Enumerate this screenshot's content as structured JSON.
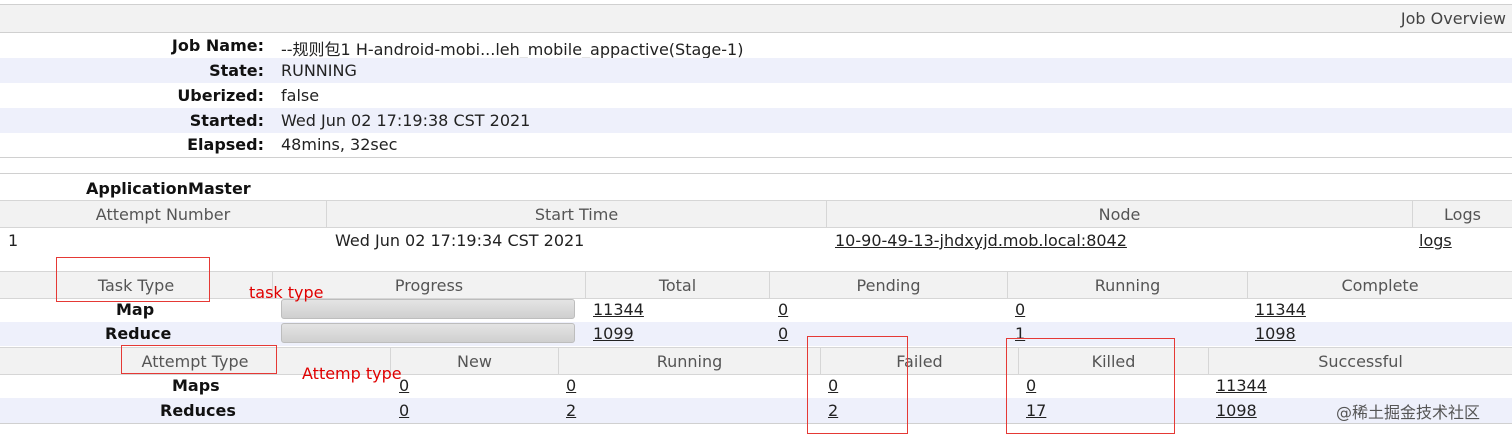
{
  "overview": {
    "title": "Job Overview",
    "rows": [
      {
        "label": "Job Name:",
        "value": "--规则包1 H-android-mobi...leh_mobile_appactive(Stage-1)"
      },
      {
        "label": "State:",
        "value": "RUNNING"
      },
      {
        "label": "Uberized:",
        "value": "false"
      },
      {
        "label": "Started:",
        "value": "Wed Jun 02 17:19:38 CST 2021"
      },
      {
        "label": "Elapsed:",
        "value": "48mins, 32sec"
      }
    ]
  },
  "am": {
    "title": "ApplicationMaster",
    "headers": [
      "Attempt Number",
      "Start Time",
      "Node",
      "Logs"
    ],
    "row": {
      "attempt": "1",
      "start": "Wed Jun 02 17:19:34 CST 2021",
      "node": "10-90-49-13-jhdxyjd.mob.local:8042",
      "logs": "logs"
    }
  },
  "tasks": {
    "headers": [
      "Task Type",
      "Progress",
      "Total",
      "Pending",
      "Running",
      "Complete"
    ],
    "rows": [
      {
        "type": "Map",
        "progress": 1.0,
        "total": "11344",
        "pending": "0",
        "running": "0",
        "complete": "11344"
      },
      {
        "type": "Reduce",
        "progress": 1.0,
        "total": "1099",
        "pending": "0",
        "running": "1",
        "complete": "1098"
      }
    ]
  },
  "attempts": {
    "headers": [
      "Attempt Type",
      "New",
      "Running",
      "Failed",
      "Killed",
      "Successful"
    ],
    "rows": [
      {
        "type": "Maps",
        "new": "0",
        "running": "0",
        "failed": "0",
        "killed": "0",
        "successful": "11344"
      },
      {
        "type": "Reduces",
        "new": "0",
        "running": "2",
        "failed": "2",
        "killed": "17",
        "successful": "1098"
      }
    ]
  },
  "annotations": {
    "task_type": "task type",
    "attempt_type": "Attemp type",
    "color": "#e00000"
  },
  "watermark": "@稀土掘金技术社区"
}
